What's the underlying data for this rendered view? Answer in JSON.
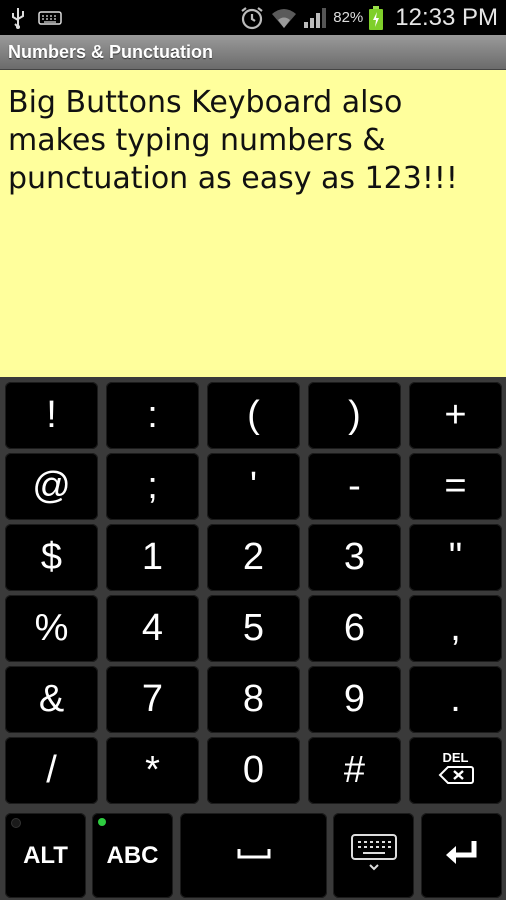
{
  "status_bar": {
    "battery_percent": "82%",
    "time": "12:33 PM",
    "icons": [
      "usb-icon",
      "keyboard-icon",
      "alarm-icon",
      "wifi-icon",
      "signal-icon",
      "battery-charging-icon"
    ]
  },
  "title": "Numbers & Punctuation",
  "note": {
    "text": "Big Buttons Keyboard also makes typing numbers & punctuation as easy as 123!!!"
  },
  "keyboard": {
    "rows": [
      [
        "!",
        ":",
        "(",
        ")",
        "+"
      ],
      [
        "@",
        ";",
        "'",
        "-",
        "="
      ],
      [
        "$",
        "1",
        "2",
        "3",
        "\""
      ],
      [
        "%",
        "4",
        "5",
        "6",
        ","
      ],
      [
        "&",
        "7",
        "8",
        "9",
        "."
      ],
      [
        "/",
        "*",
        "0",
        "#",
        ""
      ]
    ],
    "del_label": "DEL",
    "bottom": {
      "alt": "ALT",
      "abc": "ABC",
      "space": "⎵",
      "keyboard_key": "keyboard-hide-icon",
      "enter": "enter-icon"
    },
    "colors": {
      "alt_dot": "#1a1a1a",
      "abc_dot": "#2ecc40",
      "note_bg": "#ffff9c"
    }
  }
}
